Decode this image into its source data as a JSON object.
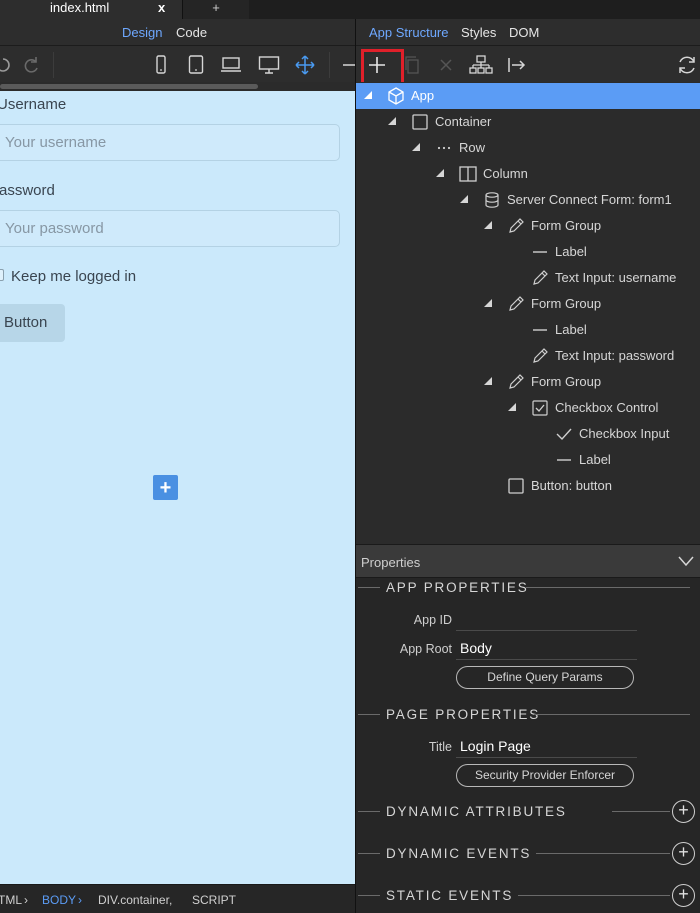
{
  "tabs": {
    "file_title": "index.html",
    "close_label": "x",
    "new_tab_label": "+"
  },
  "left_view_tabs": {
    "design": "Design",
    "code": "Code"
  },
  "toolbar_icons": [
    "undo-icon",
    "redo-icon",
    "phone-icon",
    "tablet-icon",
    "laptop-icon",
    "desktop-icon",
    "move-icon",
    "minus-icon"
  ],
  "canvas": {
    "username_label": "Username",
    "username_placeholder": "Your username",
    "password_label": "assword",
    "password_placeholder": "Your password",
    "remember_label": "Keep me logged in",
    "button_label": "Button",
    "add_label": "+"
  },
  "statusbar": {
    "c1": "TML",
    "c2": "BODY",
    "c3": "DIV.container,",
    "c4": "SCRIPT",
    "sep": "›"
  },
  "right_tabs": {
    "structure": "App Structure",
    "styles": "Styles",
    "dom": "DOM"
  },
  "tree": [
    {
      "label": "App"
    },
    {
      "label": "Container"
    },
    {
      "label": "Row"
    },
    {
      "label": "Column"
    },
    {
      "label": "Server Connect Form: form1"
    },
    {
      "label": "Form Group"
    },
    {
      "label": "Label"
    },
    {
      "label": "Text Input: username"
    },
    {
      "label": "Form Group"
    },
    {
      "label": "Label"
    },
    {
      "label": "Text Input: password"
    },
    {
      "label": "Form Group"
    },
    {
      "label": "Checkbox Control"
    },
    {
      "label": "Checkbox Input"
    },
    {
      "label": "Label"
    },
    {
      "label": "Button: button"
    }
  ],
  "properties": {
    "header": "Properties",
    "app_section": "APP PROPERTIES",
    "app_id_label": "App ID",
    "app_id_value": "",
    "app_root_label": "App Root",
    "app_root_value": "Body",
    "define_query_btn": "Define Query Params",
    "page_section": "PAGE PROPERTIES",
    "title_label": "Title",
    "title_value": "Login Page",
    "security_btn": "Security Provider Enforcer",
    "dyn_attr": "DYNAMIC ATTRIBUTES",
    "dyn_events": "DYNAMIC EVENTS",
    "static_events": "STATIC EVENTS",
    "add_symbol": "+"
  },
  "colors": {
    "accent": "#5b9cf5",
    "canvas_bg": "#cbe9fb",
    "highlight": "#e0202a"
  }
}
